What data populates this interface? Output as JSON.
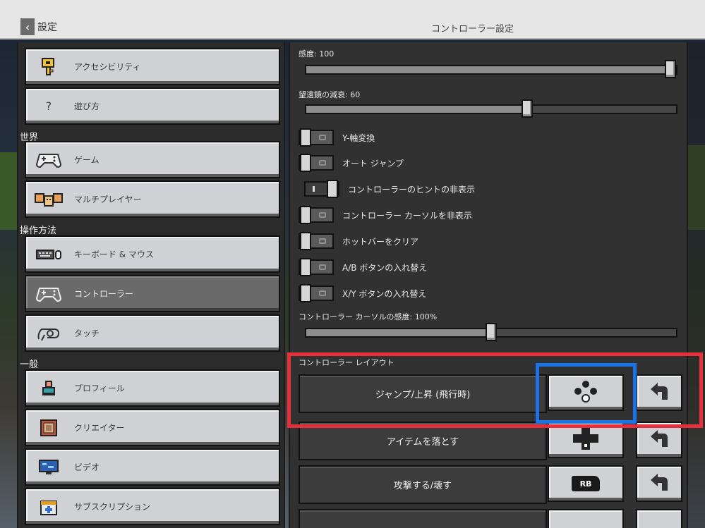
{
  "header": {
    "back_label": "設定",
    "title": "コントローラー設定"
  },
  "sidebar": {
    "items_top": [
      {
        "label": "アクセシビリティ",
        "icon": "key-icon"
      },
      {
        "label": "遊び方",
        "icon": "question-icon"
      }
    ],
    "sections": [
      {
        "title": "世界",
        "items": [
          {
            "label": "ゲーム",
            "icon": "gamepad-icon"
          },
          {
            "label": "マルチプレイヤー",
            "icon": "players-icon"
          }
        ]
      },
      {
        "title": "操作方法",
        "items": [
          {
            "label": "キーボード & マウス",
            "icon": "keyboard-mouse-icon"
          },
          {
            "label": "コントローラー",
            "icon": "gamepad-icon",
            "active": true
          },
          {
            "label": "タッチ",
            "icon": "touch-icon"
          }
        ]
      },
      {
        "title": "一般",
        "items": [
          {
            "label": "プロフィール",
            "icon": "profile-icon"
          },
          {
            "label": "クリエイター",
            "icon": "creator-icon"
          },
          {
            "label": "ビデオ",
            "icon": "video-icon"
          },
          {
            "label": "サブスクリプション",
            "icon": "subscription-icon"
          }
        ]
      }
    ]
  },
  "settings": {
    "sensitivity": {
      "label": "感度: 100",
      "value": 100,
      "max": 100
    },
    "telescope": {
      "label": "望遠鏡の減衰: 60",
      "value": 60,
      "max": 100
    },
    "toggles": [
      {
        "label": "Y-軸変換",
        "on": false
      },
      {
        "label": "オート ジャンプ",
        "on": false
      },
      {
        "label": "コントローラーのヒントの非表示",
        "on": true
      },
      {
        "label": "コントローラー カーソルを非表示",
        "on": false
      },
      {
        "label": "ホットバーをクリア",
        "on": false
      },
      {
        "label": "A/B ボタンの入れ替え",
        "on": false
      },
      {
        "label": "X/Y ボタンの入れ替え",
        "on": false
      }
    ],
    "cursor_sensitivity": {
      "label": "コントローラー カーソルの感度: 100%",
      "value": 50,
      "max": 100
    }
  },
  "layout": {
    "title": "コントローラー レイアウト",
    "bindings": [
      {
        "label": "ジャンプ/上昇 (飛行時)",
        "button": "face-buttons-icon"
      },
      {
        "label": "アイテムを落とす",
        "button": "dpad-icon"
      },
      {
        "label": "攻撃する/壊す",
        "button": "RB"
      }
    ]
  },
  "colors": {
    "highlight_red": "#e8303d",
    "highlight_blue": "#1a73e8"
  }
}
